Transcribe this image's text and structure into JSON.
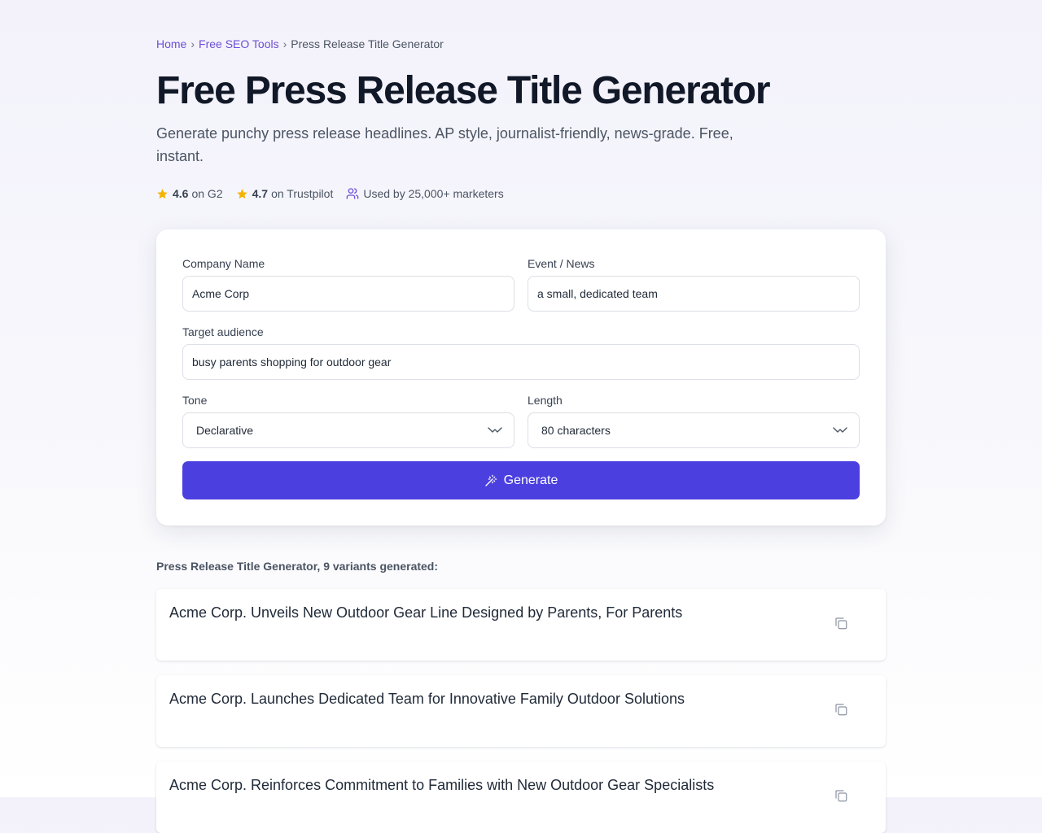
{
  "breadcrumb": {
    "home": "Home",
    "section": "Free SEO Tools",
    "current": "Press Release Title Generator",
    "separator": "›"
  },
  "page": {
    "title": "Free Press Release Title Generator",
    "subtitle": "Generate punchy press release headlines. AP style, journalist-friendly, news-grade. Free, instant."
  },
  "ratings": {
    "g2": {
      "score": "4.6",
      "label": "on G2"
    },
    "trustpilot": {
      "score": "4.7",
      "label": "on Trustpilot"
    },
    "usage": "Used by 25,000+ marketers"
  },
  "form": {
    "company": {
      "label": "Company Name",
      "value": "Acme Corp"
    },
    "event": {
      "label": "Event / News",
      "value": "a small, dedicated team"
    },
    "audience": {
      "label": "Target audience",
      "value": "busy parents shopping for outdoor gear"
    },
    "tone": {
      "label": "Tone",
      "value": "Declarative"
    },
    "length": {
      "label": "Length",
      "value": "80 characters"
    },
    "generate_label": "Generate"
  },
  "results": {
    "heading": "Press Release Title Generator, 9 variants generated:",
    "items": [
      "Acme Corp. Unveils New Outdoor Gear Line Designed by Parents, For Parents",
      "Acme Corp. Launches Dedicated Team for Innovative Family Outdoor Solutions",
      "Acme Corp. Reinforces Commitment to Families with New Outdoor Gear Specialists"
    ]
  },
  "colors": {
    "accent": "#4b3fe0",
    "link": "#6d4fd6",
    "star": "#f5b301"
  },
  "icons": {
    "star": "star-icon",
    "users": "users-icon",
    "chevron": "chevron-down-icon",
    "wand": "magic-wand-icon",
    "copy": "copy-icon"
  }
}
